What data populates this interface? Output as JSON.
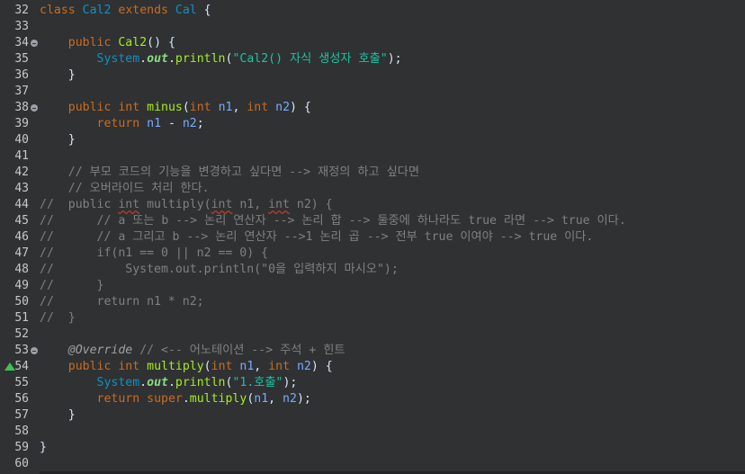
{
  "editor": {
    "lines": [
      {
        "n": "32",
        "fold": false,
        "override": false,
        "parts": [
          [
            "kw",
            "class"
          ],
          [
            "plain",
            " "
          ],
          [
            "cls",
            "Cal2"
          ],
          [
            "plain",
            " "
          ],
          [
            "kw",
            "extends"
          ],
          [
            "plain",
            " "
          ],
          [
            "cls",
            "Cal"
          ],
          [
            "plain",
            " {"
          ]
        ]
      },
      {
        "n": "33",
        "fold": false,
        "override": false,
        "parts": []
      },
      {
        "n": "34",
        "fold": true,
        "override": false,
        "parts": [
          [
            "plain",
            "    "
          ],
          [
            "kw",
            "public"
          ],
          [
            "plain",
            " "
          ],
          [
            "mth",
            "Cal2"
          ],
          [
            "plain",
            "() {"
          ]
        ]
      },
      {
        "n": "35",
        "fold": false,
        "override": false,
        "parts": [
          [
            "plain",
            "        "
          ],
          [
            "cls",
            "System"
          ],
          [
            "plain",
            "."
          ],
          [
            "fld",
            "out"
          ],
          [
            "plain",
            "."
          ],
          [
            "mth",
            "println"
          ],
          [
            "plain",
            "("
          ],
          [
            "str",
            "\"Cal2() 자식 생성자 호출\""
          ],
          [
            "plain",
            ");"
          ]
        ]
      },
      {
        "n": "36",
        "fold": false,
        "override": false,
        "parts": [
          [
            "plain",
            "    }"
          ]
        ]
      },
      {
        "n": "37",
        "fold": false,
        "override": false,
        "parts": []
      },
      {
        "n": "38",
        "fold": true,
        "override": false,
        "parts": [
          [
            "plain",
            "    "
          ],
          [
            "kw",
            "public"
          ],
          [
            "plain",
            " "
          ],
          [
            "kw",
            "int"
          ],
          [
            "plain",
            " "
          ],
          [
            "mth",
            "minus"
          ],
          [
            "plain",
            "("
          ],
          [
            "kw",
            "int"
          ],
          [
            "plain",
            " "
          ],
          [
            "var",
            "n1"
          ],
          [
            "plain",
            ", "
          ],
          [
            "kw",
            "int"
          ],
          [
            "plain",
            " "
          ],
          [
            "var",
            "n2"
          ],
          [
            "plain",
            ") {"
          ]
        ]
      },
      {
        "n": "39",
        "fold": false,
        "override": false,
        "parts": [
          [
            "plain",
            "        "
          ],
          [
            "kw",
            "return"
          ],
          [
            "plain",
            " "
          ],
          [
            "var",
            "n1"
          ],
          [
            "plain",
            " - "
          ],
          [
            "var",
            "n2"
          ],
          [
            "plain",
            ";"
          ]
        ]
      },
      {
        "n": "40",
        "fold": false,
        "override": false,
        "parts": [
          [
            "plain",
            "    }"
          ]
        ]
      },
      {
        "n": "41",
        "fold": false,
        "override": false,
        "parts": []
      },
      {
        "n": "42",
        "fold": false,
        "override": false,
        "parts": [
          [
            "plain",
            "    "
          ],
          [
            "cm",
            "// 부모 코드의 기능을 변경하고 싶다면 --> 재정의 하고 싶다면"
          ]
        ]
      },
      {
        "n": "43",
        "fold": false,
        "override": false,
        "parts": [
          [
            "plain",
            "    "
          ],
          [
            "cm",
            "// 오버라이드 처리 한다."
          ]
        ]
      },
      {
        "n": "44",
        "fold": false,
        "override": false,
        "parts": [
          [
            "cm",
            "//  public "
          ],
          [
            "cm sq",
            "int"
          ],
          [
            "cm",
            " multiply("
          ],
          [
            "cm sq",
            "int"
          ],
          [
            "cm",
            " n1, "
          ],
          [
            "cm sq",
            "int"
          ],
          [
            "cm",
            " n2) {"
          ]
        ]
      },
      {
        "n": "45",
        "fold": false,
        "override": false,
        "parts": [
          [
            "cm",
            "//      // a 또는 b --> 논리 연산자 --> 논리 합 --> 둘중에 하나라도 true 라면 --> true 이다."
          ]
        ]
      },
      {
        "n": "46",
        "fold": false,
        "override": false,
        "parts": [
          [
            "cm",
            "//      // a 그리고 b --> 논리 연산자 -->1 논리 곱 --> 전부 true 이여야 --> true 이다."
          ]
        ]
      },
      {
        "n": "47",
        "fold": false,
        "override": false,
        "parts": [
          [
            "cm",
            "//      if(n1 == 0 || n2 == 0) {"
          ]
        ]
      },
      {
        "n": "48",
        "fold": false,
        "override": false,
        "parts": [
          [
            "cm",
            "//          System.out.println(\"0을 입력하지 마시오\");"
          ]
        ]
      },
      {
        "n": "49",
        "fold": false,
        "override": false,
        "parts": [
          [
            "cm",
            "//      }"
          ]
        ]
      },
      {
        "n": "50",
        "fold": false,
        "override": false,
        "parts": [
          [
            "cm",
            "//      return n1 * n2;"
          ]
        ]
      },
      {
        "n": "51",
        "fold": false,
        "override": false,
        "parts": [
          [
            "cm",
            "//  }"
          ]
        ]
      },
      {
        "n": "52",
        "fold": false,
        "override": false,
        "parts": []
      },
      {
        "n": "53",
        "fold": true,
        "override": false,
        "parts": [
          [
            "plain",
            "    "
          ],
          [
            "ann",
            "@Override"
          ],
          [
            "plain",
            " "
          ],
          [
            "cm",
            "// <-- 어노테이션 --> 주석 + 힌트"
          ]
        ]
      },
      {
        "n": "54",
        "fold": false,
        "override": true,
        "parts": [
          [
            "plain",
            "    "
          ],
          [
            "kw",
            "public"
          ],
          [
            "plain",
            " "
          ],
          [
            "kw",
            "int"
          ],
          [
            "plain",
            " "
          ],
          [
            "mth",
            "multiply"
          ],
          [
            "plain",
            "("
          ],
          [
            "kw",
            "int"
          ],
          [
            "plain",
            " "
          ],
          [
            "var",
            "n1"
          ],
          [
            "plain",
            ", "
          ],
          [
            "kw",
            "int"
          ],
          [
            "plain",
            " "
          ],
          [
            "var",
            "n2"
          ],
          [
            "plain",
            ") {"
          ]
        ]
      },
      {
        "n": "55",
        "fold": false,
        "override": false,
        "parts": [
          [
            "plain",
            "        "
          ],
          [
            "cls",
            "System"
          ],
          [
            "plain",
            "."
          ],
          [
            "fld",
            "out"
          ],
          [
            "plain",
            "."
          ],
          [
            "mth",
            "println"
          ],
          [
            "plain",
            "("
          ],
          [
            "str",
            "\"1.호출\""
          ],
          [
            "plain",
            ");"
          ]
        ]
      },
      {
        "n": "56",
        "fold": false,
        "override": false,
        "parts": [
          [
            "plain",
            "        "
          ],
          [
            "kw",
            "return"
          ],
          [
            "plain",
            " "
          ],
          [
            "kw",
            "super"
          ],
          [
            "plain",
            "."
          ],
          [
            "mth",
            "multiply"
          ],
          [
            "plain",
            "("
          ],
          [
            "var",
            "n1"
          ],
          [
            "plain",
            ", "
          ],
          [
            "var",
            "n2"
          ],
          [
            "plain",
            ");"
          ]
        ]
      },
      {
        "n": "57",
        "fold": false,
        "override": false,
        "parts": [
          [
            "plain",
            "    }"
          ]
        ]
      },
      {
        "n": "58",
        "fold": false,
        "override": false,
        "parts": []
      },
      {
        "n": "59",
        "fold": false,
        "override": false,
        "parts": [
          [
            "plain",
            "}"
          ]
        ]
      },
      {
        "n": "60",
        "fold": false,
        "override": false,
        "parts": []
      }
    ]
  },
  "colors": {
    "background": "#2f3133",
    "keyword": "#cc6c1d",
    "class": "#1290c3",
    "string": "#17c6a3",
    "method": "#a7ec21",
    "variable": "#79abff",
    "comment": "#808080"
  }
}
